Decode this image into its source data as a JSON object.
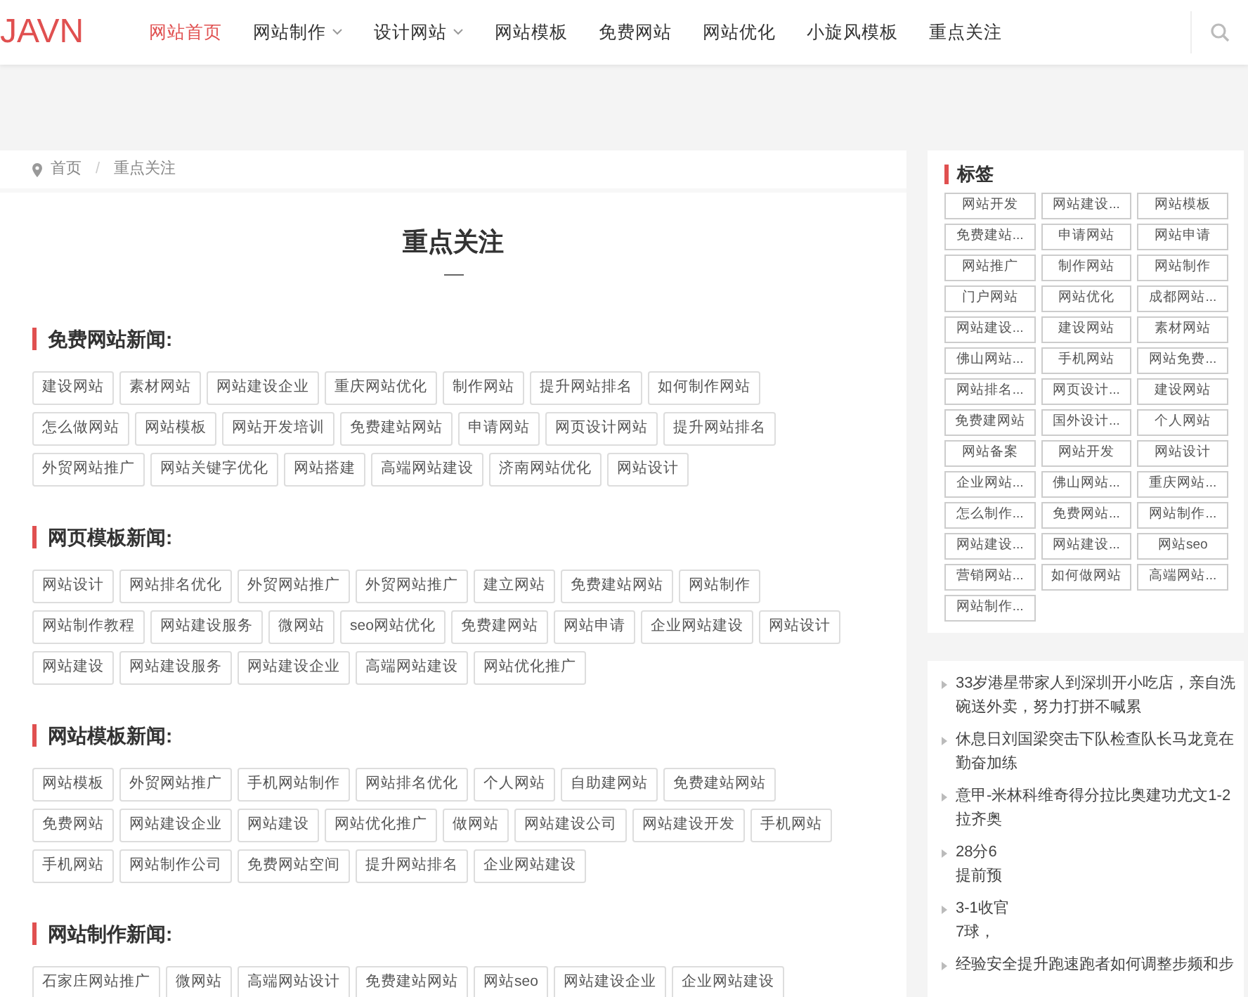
{
  "header": {
    "logo": "JAVN",
    "nav": [
      {
        "label": "网站首页",
        "selected": true,
        "dropdown": false
      },
      {
        "label": "网站制作",
        "selected": false,
        "dropdown": true
      },
      {
        "label": "设计网站",
        "selected": false,
        "dropdown": true
      },
      {
        "label": "网站模板",
        "selected": false,
        "dropdown": false
      },
      {
        "label": "免费网站",
        "selected": false,
        "dropdown": false
      },
      {
        "label": "网站优化",
        "selected": false,
        "dropdown": false
      },
      {
        "label": "小旋风模板",
        "selected": false,
        "dropdown": false
      },
      {
        "label": "重点关注",
        "selected": false,
        "dropdown": false
      }
    ]
  },
  "breadcrumb": [
    "首页",
    "/",
    "重点关注"
  ],
  "page_title": "重点关注",
  "sections": [
    {
      "title": "免费网站新闻:",
      "rows": [
        [
          "建设网站",
          "素材网站",
          "网站建设企业",
          "重庆网站优化",
          "制作网站",
          "提升网站排名",
          "如何制作网站"
        ],
        [
          "怎么做网站",
          "网站模板",
          "网站开发培训",
          "免费建站网站",
          "申请网站",
          "网页设计网站",
          "提升网站排名"
        ],
        [
          "外贸网站推广",
          "网站关键字优化",
          "网站搭建",
          "高端网站建设",
          "济南网站优化",
          "网站设计"
        ]
      ]
    },
    {
      "title": "网页模板新闻:",
      "rows": [
        [
          "网站设计",
          "网站排名优化",
          "外贸网站推广",
          "外贸网站推广",
          "建立网站",
          "免费建站网站",
          "网站制作"
        ],
        [
          "网站制作教程",
          "网站建设服务",
          "微网站",
          "seo网站优化",
          "免费建网站",
          "网站申请",
          "企业网站建设",
          "网站设计"
        ],
        [
          "网站建设",
          "网站建设服务",
          "网站建设企业",
          "高端网站建设",
          "网站优化推广"
        ]
      ]
    },
    {
      "title": "网站模板新闻:",
      "rows": [
        [
          "网站模板",
          "外贸网站推广",
          "手机网站制作",
          "网站排名优化",
          "个人网站",
          "自助建网站",
          "免费建站网站"
        ],
        [
          "免费网站",
          "网站建设企业",
          "网站建设",
          "网站优化推广",
          "做网站",
          "网站建设公司",
          "网站建设开发",
          "手机网站"
        ],
        [
          "手机网站",
          "网站制作公司",
          "免费网站空间",
          "提升网站排名",
          "企业网站建设"
        ]
      ]
    },
    {
      "title": "网站制作新闻:",
      "rows": [
        [
          "石家庄网站推广",
          "微网站",
          "高端网站设计",
          "免费建站网站",
          "网站seo",
          "网站建设企业",
          "企业网站建设"
        ]
      ]
    }
  ],
  "sidebar": {
    "tags_title": "标签",
    "tags": [
      "网站开发",
      "网站建设...",
      "网站模板",
      "免费建站...",
      "申请网站",
      "网站申请",
      "网站推广",
      "制作网站",
      "网站制作",
      "门户网站",
      "网站优化",
      "成都网站...",
      "网站建设...",
      "建设网站",
      "素材网站",
      "佛山网站...",
      "手机网站",
      "网站免费...",
      "网站排名...",
      "网页设计...",
      "建设网站",
      "免费建网站",
      "国外设计...",
      "个人网站",
      "网站备案",
      "网站开发",
      "网站设计",
      "企业网站...",
      "佛山网站...",
      "重庆网站...",
      "怎么制作...",
      "免费网站...",
      "网站制作...",
      "网站建设...",
      "网站建设...",
      "网站seo",
      "营销网站...",
      "如何做网站",
      "高端网站...",
      "网站制作..."
    ],
    "news": [
      {
        "lines": [
          "33岁港星带家人到深圳开小吃店，亲自洗",
          "碗送外卖，努力打拼不喊累"
        ]
      },
      {
        "lines": [
          "休息日刘国梁突击下队检查队长马龙竟在",
          "勤奋加练"
        ]
      },
      {
        "lines": [
          "意甲-米林科维奇得分拉比奥建功尤文1-2",
          "拉齐奥"
        ]
      },
      {
        "lines": [
          "28分6",
          "提前预"
        ]
      },
      {
        "lines": [
          "3-1收官",
          "7球，"
        ]
      },
      {
        "lines": [
          "经验安全提升跑速跑者如何调整步频和步"
        ]
      }
    ]
  }
}
